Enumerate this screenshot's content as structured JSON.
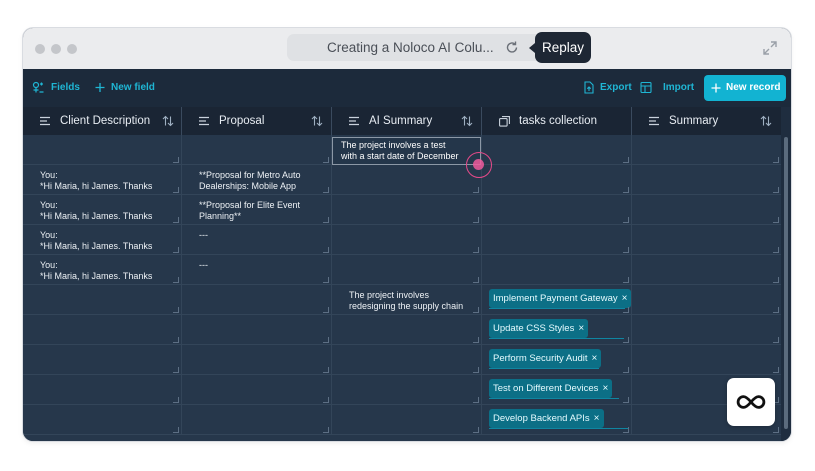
{
  "browser": {
    "url_title": "Creating a Noloco AI Colu...",
    "replay_label": "Replay"
  },
  "toolbar": {
    "fields_label": "Fields",
    "new_field_label": "New field",
    "export_label": "Export",
    "import_label": "Import",
    "new_record_label": "New record"
  },
  "columns": [
    {
      "label": "Client Description",
      "icon": "lines-icon",
      "sortable": true
    },
    {
      "label": "Proposal",
      "icon": "lines-icon",
      "sortable": true
    },
    {
      "label": "AI Summary",
      "icon": "lines-icon",
      "sortable": true
    },
    {
      "label": "tasks collection",
      "icon": "relation-icon",
      "sortable": false
    },
    {
      "label": "Summary",
      "icon": "lines-icon",
      "sortable": true
    }
  ],
  "rows": [
    [
      "",
      "",
      "",
      "",
      ""
    ],
    [
      "You:\n*Hi Maria, hi James. Thanks",
      "**Proposal for Metro Auto\nDealerships: Mobile App",
      "",
      "",
      ""
    ],
    [
      "You:\n*Hi Maria, hi James. Thanks",
      "**Proposal for Elite Event\nPlanning**",
      "",
      "",
      ""
    ],
    [
      "You:\n*Hi Maria, hi James. Thanks",
      "---",
      "",
      "",
      ""
    ],
    [
      "You:\n*Hi Maria, hi James. Thanks",
      "---",
      "",
      "",
      ""
    ],
    [
      "",
      "",
      "The project involves\nredesigning the supply chain",
      "",
      ""
    ],
    [
      "",
      "",
      "",
      "",
      ""
    ],
    [
      "",
      "",
      "",
      "",
      ""
    ],
    [
      "",
      "",
      "",
      "",
      ""
    ],
    [
      "",
      "",
      "",
      "",
      ""
    ]
  ],
  "ai_editing": {
    "text": "The project involves a test\nwith a start date of December"
  },
  "tasks": [
    {
      "label": "Implement Payment Gateway"
    },
    {
      "label": "Update CSS Styles"
    },
    {
      "label": "Perform Security Audit"
    },
    {
      "label": "Test on Different Devices"
    },
    {
      "label": "Develop Backend APIs"
    }
  ],
  "colors": {
    "accent": "#12b3d2",
    "tag_bg": "#0c6f86",
    "grid_bg": "#26374b",
    "header_bg": "#1a2534",
    "cursor": "#e64a8a"
  }
}
